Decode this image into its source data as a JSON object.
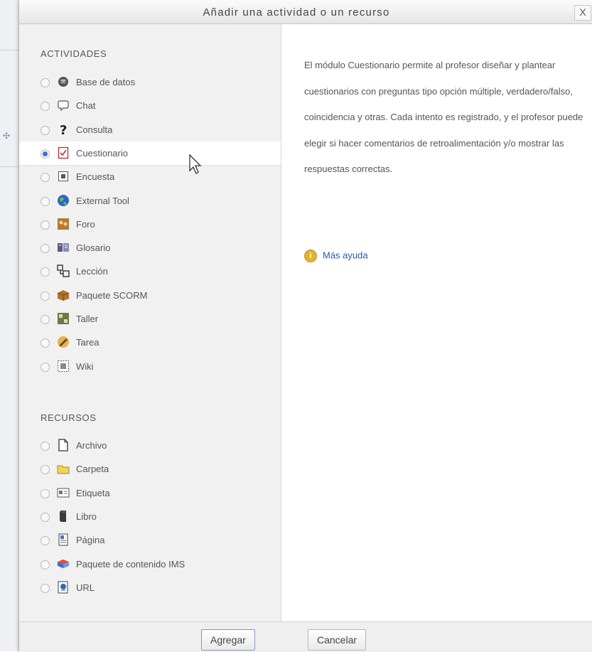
{
  "dialog": {
    "title": "Añadir una actividad o un recurso",
    "close_label": "X"
  },
  "sections": {
    "activities_heading": "ACTIVIDADES",
    "resources_heading": "RECURSOS"
  },
  "activities": [
    {
      "label": "Base de datos",
      "icon": "database-icon",
      "selected": false
    },
    {
      "label": "Chat",
      "icon": "chat-icon",
      "selected": false
    },
    {
      "label": "Consulta",
      "icon": "question-mark-icon",
      "selected": false
    },
    {
      "label": "Cuestionario",
      "icon": "quiz-icon",
      "selected": true
    },
    {
      "label": "Encuesta",
      "icon": "survey-icon",
      "selected": false
    },
    {
      "label": "External Tool",
      "icon": "globe-icon",
      "selected": false
    },
    {
      "label": "Foro",
      "icon": "forum-icon",
      "selected": false
    },
    {
      "label": "Glosario",
      "icon": "glossary-icon",
      "selected": false
    },
    {
      "label": "Lección",
      "icon": "lesson-icon",
      "selected": false
    },
    {
      "label": "Paquete SCORM",
      "icon": "package-icon",
      "selected": false
    },
    {
      "label": "Taller",
      "icon": "workshop-icon",
      "selected": false
    },
    {
      "label": "Tarea",
      "icon": "assignment-icon",
      "selected": false
    },
    {
      "label": "Wiki",
      "icon": "wiki-icon",
      "selected": false
    }
  ],
  "resources": [
    {
      "label": "Archivo",
      "icon": "file-icon",
      "selected": false
    },
    {
      "label": "Carpeta",
      "icon": "folder-icon",
      "selected": false
    },
    {
      "label": "Etiqueta",
      "icon": "label-icon",
      "selected": false
    },
    {
      "label": "Libro",
      "icon": "book-icon",
      "selected": false
    },
    {
      "label": "Página",
      "icon": "page-icon",
      "selected": false
    },
    {
      "label": "Paquete de contenido IMS",
      "icon": "ims-package-icon",
      "selected": false
    },
    {
      "label": "URL",
      "icon": "url-icon",
      "selected": false
    }
  ],
  "description": {
    "text": "El módulo Cuestionario permite al profesor diseñar y plantear cuestionarios con preguntas tipo opción múltiple, verdadero/falso, coincidencia y otras. Cada intento es registrado, y el profesor puede elegir si hacer comentarios de retroalimentación y/o mostrar las respuestas correctas.",
    "help_link": "Más ayuda"
  },
  "footer": {
    "add_label": "Agregar",
    "cancel_label": "Cancelar"
  },
  "colors": {
    "accent": "#3d6fd0",
    "link": "#2a53c4"
  }
}
